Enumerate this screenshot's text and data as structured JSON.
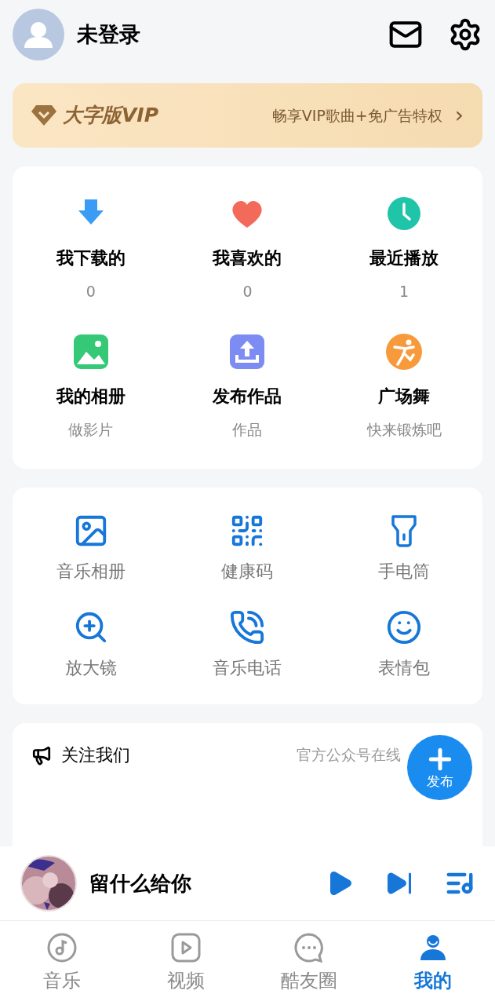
{
  "header": {
    "username": "未登录"
  },
  "vip_banner": {
    "title": "大字版VIP",
    "promo": "畅享VIP歌曲+免广告特权",
    "arrow": "›"
  },
  "my_items": [
    {
      "label": "我下载的",
      "sub": "0"
    },
    {
      "label": "我喜欢的",
      "sub": "0"
    },
    {
      "label": "最近播放",
      "sub": "1"
    },
    {
      "label": "我的相册",
      "sub": "做影片"
    },
    {
      "label": "发布作品",
      "sub": "作品"
    },
    {
      "label": "广场舞",
      "sub": "快来锻炼吧"
    }
  ],
  "tools": [
    {
      "label": "音乐相册"
    },
    {
      "label": "健康码"
    },
    {
      "label": "手电筒"
    },
    {
      "label": "放大镜"
    },
    {
      "label": "音乐电话"
    },
    {
      "label": "表情包"
    }
  ],
  "follow": {
    "title": "关注我们",
    "desc": "官方公众号在线"
  },
  "fab": {
    "label": "发布"
  },
  "player": {
    "song": "留什么给你"
  },
  "tabs": [
    {
      "label": "音乐",
      "selected": false
    },
    {
      "label": "视频",
      "selected": false
    },
    {
      "label": "酷友圈",
      "selected": false
    },
    {
      "label": "我的",
      "selected": true
    }
  ]
}
